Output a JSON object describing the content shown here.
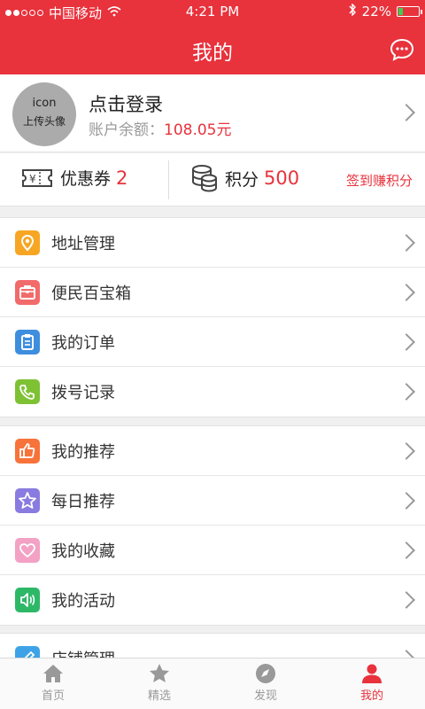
{
  "status_bar": {
    "carrier": "中国移动",
    "time": "4:21 PM",
    "battery": "22%",
    "battery_level": 0.22
  },
  "header": {
    "title": "我的",
    "message_icon": "chat-bubble-icon"
  },
  "profile": {
    "avatar_icon_text": "icon",
    "avatar_upload_text": "上传头像",
    "login_text": "点击登录",
    "balance_label": "账户余额：",
    "balance_value": "108.05元"
  },
  "stats": {
    "coupon_label": "优惠券",
    "coupon_count": "2",
    "points_label": "积分",
    "points_value": "500",
    "sign_in_text": "签到赚积分"
  },
  "menu_groups": [
    [
      {
        "label": "地址管理",
        "icon": "location-pin-icon",
        "color": "#f6a623"
      },
      {
        "label": "便民百宝箱",
        "icon": "toolbox-icon",
        "color": "#f16b6b"
      },
      {
        "label": "我的订单",
        "icon": "clipboard-icon",
        "color": "#3e8ede"
      },
      {
        "label": "拨号记录",
        "icon": "phone-icon",
        "color": "#7ec234"
      }
    ],
    [
      {
        "label": "我的推荐",
        "icon": "thumbs-up-icon",
        "color": "#f7733a"
      },
      {
        "label": "每日推荐",
        "icon": "star-icon",
        "color": "#8a7be0"
      },
      {
        "label": "我的收藏",
        "icon": "heart-icon",
        "color": "#f3a1c4"
      },
      {
        "label": "我的活动",
        "icon": "speaker-icon",
        "color": "#2db868"
      }
    ],
    [
      {
        "label": "店铺管理",
        "icon": "edit-icon",
        "color": "#3ea3e6"
      }
    ]
  ],
  "tabbar": [
    {
      "label": "首页",
      "icon": "home-icon",
      "active": false
    },
    {
      "label": "精选",
      "icon": "star-icon",
      "active": false
    },
    {
      "label": "发现",
      "icon": "compass-icon",
      "active": false
    },
    {
      "label": "我的",
      "icon": "person-icon",
      "active": true
    }
  ],
  "colors": {
    "brand": "#e8323c",
    "background": "#f0f0f0"
  }
}
